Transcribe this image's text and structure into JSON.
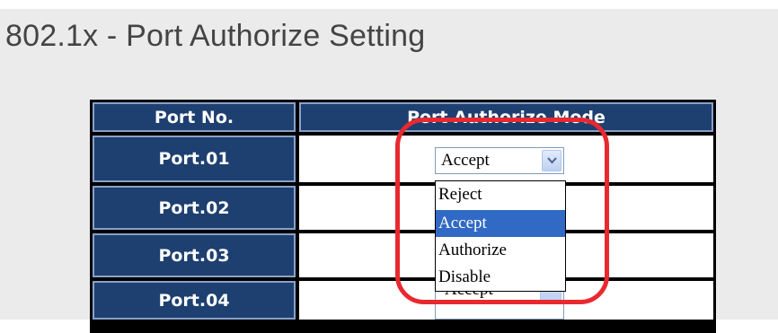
{
  "page": {
    "title": "802.1x - Port Authorize Setting"
  },
  "table": {
    "headers": {
      "port": "Port No.",
      "mode": "Port Authorize Mode"
    },
    "rows": [
      {
        "port": "Port.01",
        "mode": "Accept"
      },
      {
        "port": "Port.02",
        "mode": ""
      },
      {
        "port": "Port.03",
        "mode": ""
      },
      {
        "port": "Port.04",
        "mode": "Accept"
      }
    ]
  },
  "dropdown": {
    "selected": "Accept",
    "options": [
      "Reject",
      "Accept",
      "Authorize",
      "Disable"
    ],
    "highlighted_option": "Accept"
  },
  "colors": {
    "header_bg": "#1e4070",
    "selected_option_bg": "#316ac5",
    "highlight_ring": "#e8292f",
    "panel_bg": "#ebebeb"
  },
  "icons": {
    "select_arrow": "chevron-down-icon"
  }
}
